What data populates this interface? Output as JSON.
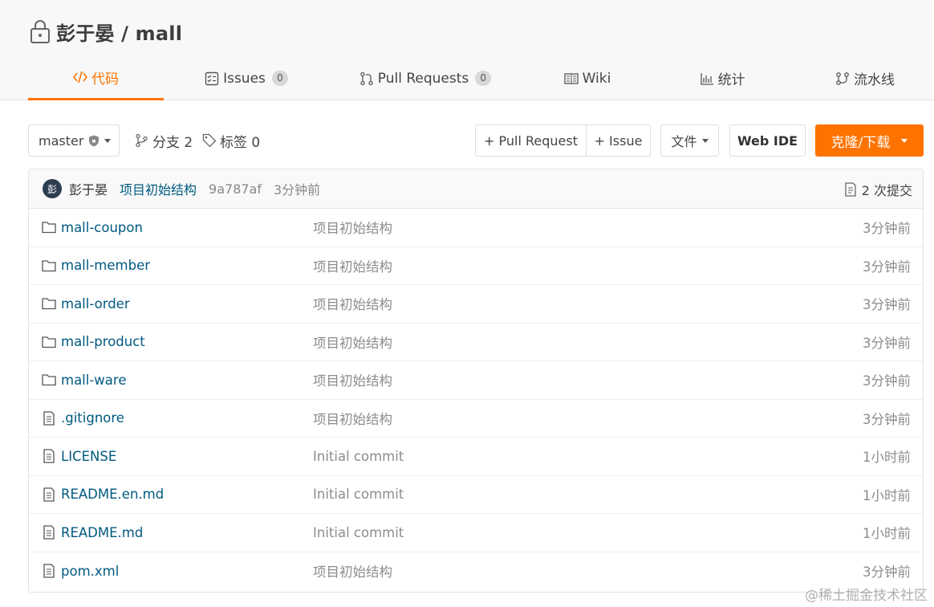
{
  "repo": {
    "title": "彭于晏 / mall"
  },
  "tabs": [
    {
      "label": "代码",
      "icon": "code-icon",
      "active": true
    },
    {
      "label": "Issues",
      "icon": "issues-icon",
      "count": "0"
    },
    {
      "label": "Pull Requests",
      "icon": "pull-request-icon",
      "count": "0"
    },
    {
      "label": "Wiki",
      "icon": "wiki-icon"
    },
    {
      "label": "统计",
      "icon": "stats-icon"
    },
    {
      "label": "流水线",
      "icon": "pipeline-icon"
    }
  ],
  "toolbar": {
    "branch": "master",
    "branches": "分支 2",
    "tags": "标签 0",
    "pull_request_btn": "+ Pull Request",
    "issue_btn": "+ Issue",
    "files_btn": "文件",
    "web_ide_btn": "Web IDE",
    "clone_btn": "克隆/下载",
    "accent_color": "#fe7300"
  },
  "commit": {
    "avatar_text": "彭",
    "author": "彭于晏",
    "message": "项目初始结构",
    "sha": "9a787af",
    "time": "3分钟前",
    "count_label": "2 次提交"
  },
  "files": [
    {
      "name": "mall-coupon",
      "type": "folder",
      "message": "项目初始结构",
      "time": "3分钟前"
    },
    {
      "name": "mall-member",
      "type": "folder",
      "message": "项目初始结构",
      "time": "3分钟前"
    },
    {
      "name": "mall-order",
      "type": "folder",
      "message": "项目初始结构",
      "time": "3分钟前"
    },
    {
      "name": "mall-product",
      "type": "folder",
      "message": "项目初始结构",
      "time": "3分钟前"
    },
    {
      "name": "mall-ware",
      "type": "folder",
      "message": "项目初始结构",
      "time": "3分钟前"
    },
    {
      "name": ".gitignore",
      "type": "file",
      "message": "项目初始结构",
      "time": "3分钟前"
    },
    {
      "name": "LICENSE",
      "type": "file",
      "message": "Initial commit",
      "time": "1小时前"
    },
    {
      "name": "README.en.md",
      "type": "file",
      "message": "Initial commit",
      "time": "1小时前"
    },
    {
      "name": "README.md",
      "type": "file",
      "message": "Initial commit",
      "time": "1小时前"
    },
    {
      "name": "pom.xml",
      "type": "file",
      "message": "项目初始结构",
      "time": "3分钟前"
    }
  ],
  "watermark": "@稀土掘金技术社区"
}
